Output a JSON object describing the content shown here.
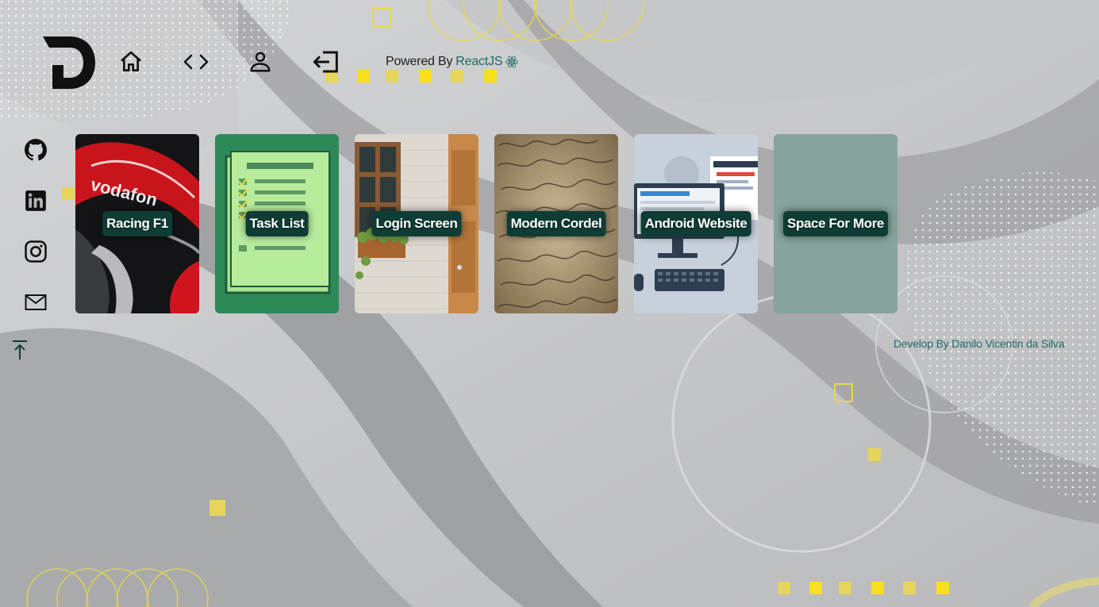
{
  "header": {
    "logo_icon": "letter-d-logo",
    "nav": [
      {
        "name": "home",
        "icon": "home-icon"
      },
      {
        "name": "code",
        "icon": "code-icon"
      },
      {
        "name": "profile",
        "icon": "person-icon"
      },
      {
        "name": "login",
        "icon": "login-icon"
      }
    ],
    "powered_prefix": "Powered By",
    "powered_brand": "ReactJS",
    "powered_icon": "react-icon"
  },
  "sidebar": {
    "items": [
      {
        "name": "github",
        "icon": "github-icon"
      },
      {
        "name": "linkedin",
        "icon": "linkedin-icon"
      },
      {
        "name": "instagram",
        "icon": "instagram-icon"
      },
      {
        "name": "email",
        "icon": "mail-icon"
      }
    ],
    "scroll_top_icon": "arrow-up-to-top-icon"
  },
  "projects": [
    {
      "label": "Racing F1"
    },
    {
      "label": "Task List"
    },
    {
      "label": "Login Screen"
    },
    {
      "label": "Modern Cordel"
    },
    {
      "label": "Android Website"
    },
    {
      "label": "Space For More"
    }
  ],
  "footer": {
    "develop": "Develop By Danilo Vicentin da Silva"
  },
  "colors": {
    "accent_teal": "#1d6a62",
    "label_bg": "#0f3d36",
    "deco_yellow": "#f5dc2a",
    "background": "#b4b5b7"
  }
}
